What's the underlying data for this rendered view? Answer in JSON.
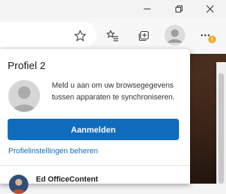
{
  "window_controls": {
    "minimize_icon": "minimize-icon",
    "restore_icon": "restore-icon",
    "close_icon": "close-icon"
  },
  "toolbar": {
    "favorite_icon": "star-outline-icon",
    "favorites_icon": "favorites-list-icon",
    "collections_icon": "collections-icon",
    "profile_icon": "profile-avatar-icon",
    "more_icon": "ellipsis-icon",
    "notification_color": "#f5a623"
  },
  "profile_panel": {
    "title": "Profiel 2",
    "signin_text": "Meld u aan om uw browsegegevens tussen apparaten te synchroniseren.",
    "signin_button": "Aanmelden",
    "manage_link": "Profielinstellingen beheren",
    "other_profile_name": "Ed OfficeContent",
    "accent_color": "#0f6cbd"
  }
}
